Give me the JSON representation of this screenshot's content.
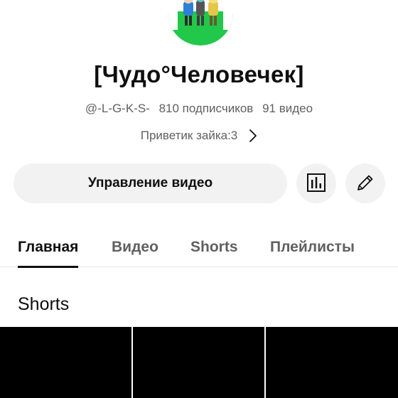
{
  "channel": {
    "avatar_icon": "avatar-icon",
    "name": "[Чудо°Человечек]",
    "handle": "@-L-G-K-S-",
    "subscribers": "810 подписчиков",
    "videos": "91 видео",
    "description": "Приветик зайка:3"
  },
  "actions": {
    "manage_label": "Управление видео",
    "stats_icon": "analytics-icon",
    "edit_icon": "pencil-icon"
  },
  "tabs": [
    {
      "label": "Главная",
      "active": true
    },
    {
      "label": "Видео",
      "active": false
    },
    {
      "label": "Shorts",
      "active": false
    },
    {
      "label": "Плейлисты",
      "active": false
    }
  ],
  "sections": {
    "shorts_title": "Shorts"
  },
  "colors": {
    "text_primary": "#0f0f0f",
    "text_secondary": "#606060",
    "button_bg": "#f2f2f2",
    "avatar_ring": "#22c84a"
  }
}
